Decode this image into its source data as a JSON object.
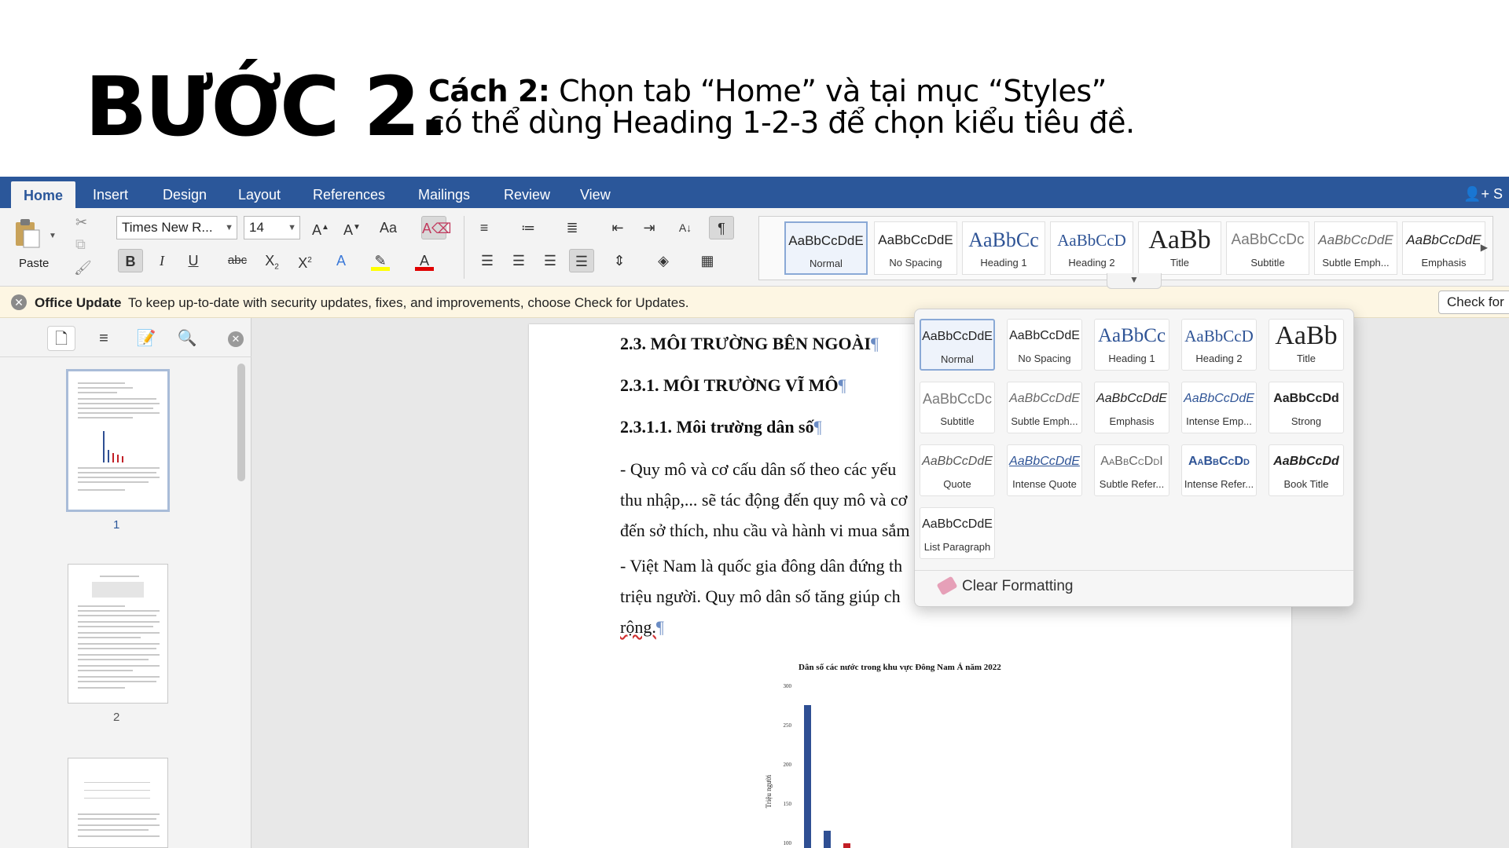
{
  "instruction": {
    "step_title": "BƯỚC 2.",
    "desc_prefix": "Cách 2:",
    "desc_line1_rest": " Chọn tab “Home” và tại mục “Styles”",
    "desc_line2": "có thể dùng Heading 1-2-3 để chọn kiểu tiêu đề."
  },
  "ribbon": {
    "tabs": [
      "Home",
      "Insert",
      "Design",
      "Layout",
      "References",
      "Mailings",
      "Review",
      "View"
    ],
    "active_tab": "Home",
    "share_label": "S",
    "paste_label": "Paste",
    "font_name": "Times New R...",
    "font_size": "14",
    "gallery_styles": [
      {
        "preview": "AaBbCcDdE",
        "name": "Normal",
        "selected": true
      },
      {
        "preview": "AaBbCcDdE",
        "name": "No Spacing"
      },
      {
        "preview": "AaBbCc",
        "name": "Heading 1"
      },
      {
        "preview": "AaBbCcD",
        "name": "Heading 2"
      },
      {
        "preview": "AaBb",
        "name": "Title"
      },
      {
        "preview": "AaBbCcDc",
        "name": "Subtitle"
      },
      {
        "preview": "AaBbCcDdE",
        "name": "Subtle Emph..."
      },
      {
        "preview": "AaBbCcDdE",
        "name": "Emphasis"
      }
    ]
  },
  "update_bar": {
    "title": "Office Update",
    "message": "To keep up-to-date with security updates, fixes, and improvements, choose Check for Updates.",
    "button": "Check for"
  },
  "nav_pane": {
    "page_numbers": [
      "1",
      "2"
    ]
  },
  "document": {
    "lines": [
      "2.3. MÔI TRƯỜNG BÊN NGOÀI",
      "2.3.1. MÔI TRƯỜNG VĨ MÔ",
      "2.3.1.1. Môi trường dân số",
      "- Quy mô và cơ cấu dân số theo các yếu",
      "thu nhập,... sẽ tác động đến quy mô và cơ",
      "đến sở thích, nhu cầu và hành vi mua sắm",
      "- Việt Nam là quốc gia đông dân đứng th",
      "triệu người. Quy mô dân số tăng giúp ch",
      "rộng."
    ],
    "pilcrow": "¶"
  },
  "chart_data": {
    "type": "bar",
    "title": "Dân số các nước trong khu vực Đông Nam Á năm 2022",
    "ylabel": "Triệu người",
    "yticks": [
      "300",
      "250",
      "200",
      "150",
      "100"
    ],
    "ylim": [
      100,
      300
    ],
    "series": [
      {
        "values": [
          275,
          115,
          99
        ],
        "colors": [
          "#2f4f93",
          "#2f4f93",
          "#c21f26"
        ]
      }
    ]
  },
  "styles_dropdown": {
    "styles": [
      {
        "preview": "AaBbCcDdE",
        "name": "Normal",
        "selected": true
      },
      {
        "preview": "AaBbCcDdE",
        "name": "No Spacing"
      },
      {
        "preview": "AaBbCc",
        "name": "Heading 1"
      },
      {
        "preview": "AaBbCcD",
        "name": "Heading 2"
      },
      {
        "preview": "AaBb",
        "name": "Title"
      },
      {
        "preview": "AaBbCcDc",
        "name": "Subtitle"
      },
      {
        "preview": "AaBbCcDdE",
        "name": "Subtle Emph..."
      },
      {
        "preview": "AaBbCcDdE",
        "name": "Emphasis"
      },
      {
        "preview": "AaBbCcDdE",
        "name": "Intense Emp..."
      },
      {
        "preview": "AaBbCcDd",
        "name": "Strong"
      },
      {
        "preview": "AaBbCcDdE",
        "name": "Quote"
      },
      {
        "preview": "AaBbCcDdE",
        "name": "Intense Quote"
      },
      {
        "preview": "AaBbCcDdI",
        "name": "Subtle Refer..."
      },
      {
        "preview": "AaBbCcDd",
        "name": "Intense Refer..."
      },
      {
        "preview": "AaBbCcDd",
        "name": "Book Title"
      },
      {
        "preview": "AaBbCcDdE",
        "name": "List Paragraph"
      }
    ],
    "clear_formatting": "Clear Formatting"
  },
  "colors": {
    "ribbon_blue": "#2b579a",
    "heading_blue": "#2f5496",
    "chart_blue": "#2f4f93",
    "chart_red": "#c21f26"
  }
}
